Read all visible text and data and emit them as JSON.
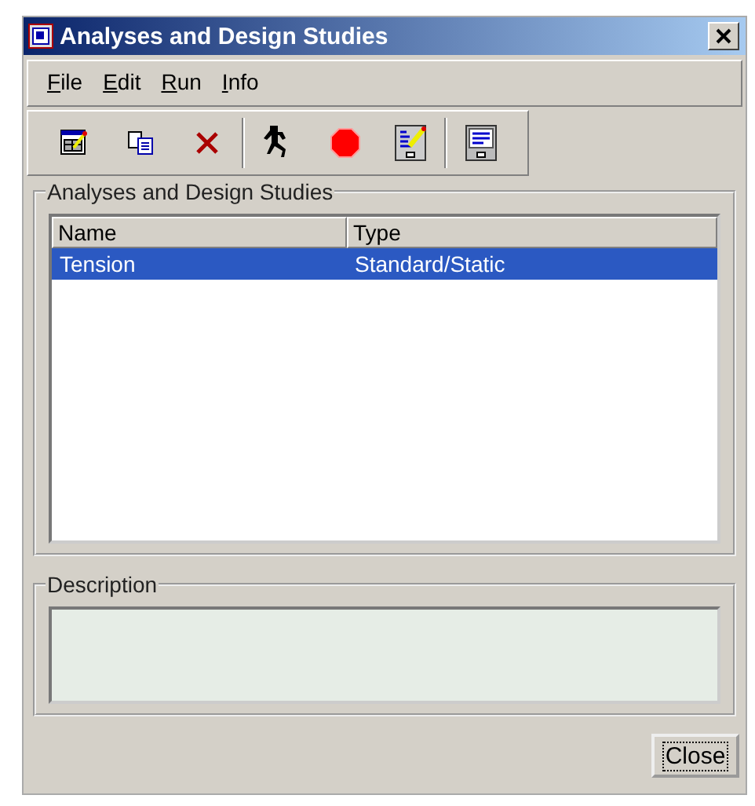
{
  "window": {
    "title": "Analyses and Design Studies"
  },
  "menu": [
    {
      "label": "File"
    },
    {
      "label": "Edit"
    },
    {
      "label": "Run"
    },
    {
      "label": "Info"
    }
  ],
  "toolbar": [
    {
      "kind": "new"
    },
    {
      "kind": "copy"
    },
    {
      "kind": "delete"
    },
    {
      "kind": "separator"
    },
    {
      "kind": "run"
    },
    {
      "kind": "stop"
    },
    {
      "kind": "edit"
    },
    {
      "kind": "separator"
    },
    {
      "kind": "status"
    }
  ],
  "studies": {
    "title": "Analyses and Design Studies",
    "columns": [
      "Name",
      "Type"
    ],
    "rows": [
      {
        "cells": [
          "Tension",
          "Standard/Static"
        ],
        "selected": true
      }
    ]
  },
  "description": {
    "title": "Description"
  },
  "buttons": [
    {
      "label": "Close",
      "focused": true
    }
  ]
}
